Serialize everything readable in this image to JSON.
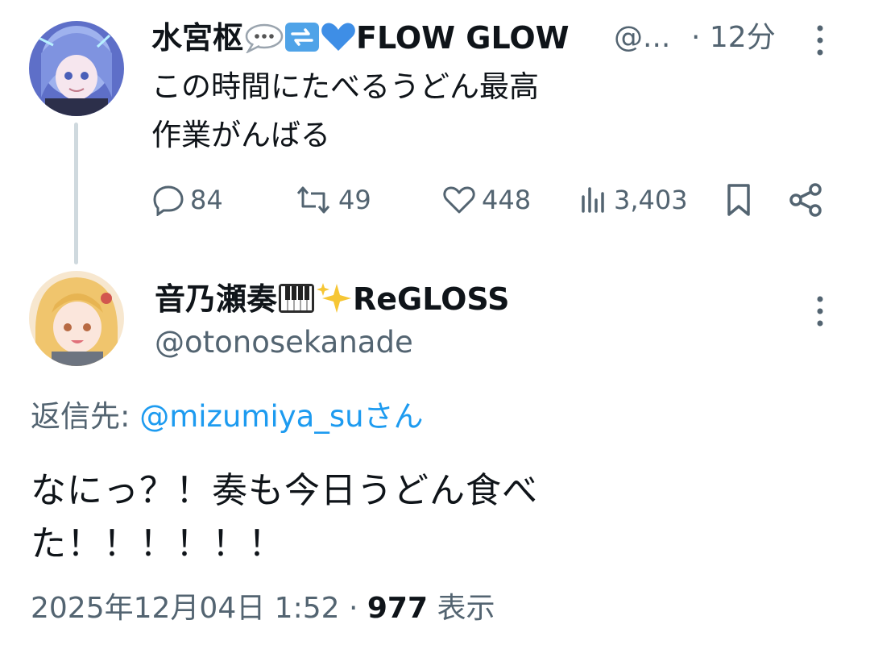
{
  "tweet1": {
    "display_name": "水宮枢",
    "name_suffix": "FLOW GLOW",
    "handle": "@...",
    "time": "· 12分",
    "text_line1": "この時間にたべるうどん最高",
    "text_line2": "作業がんばる",
    "stats": {
      "replies": "84",
      "reposts": "49",
      "likes": "448",
      "views": "3,403"
    },
    "avatar_color": "#7c8fd0"
  },
  "tweet2": {
    "display_name": "音乃瀬奏",
    "name_suffix": "ReGLOSS",
    "handle": "@otonosekanade",
    "reply_prefix": "返信先: ",
    "reply_target": "@mizumiya_suさん",
    "text_line1": "なにっ？！奏も今日うどん食べ",
    "text_line2": "た！！！！！！",
    "date": "2025年12月04日 1:52 · ",
    "view_count": "977",
    "view_label": " 表示",
    "avatar_color": "#f1c98a"
  },
  "colors": {
    "accent": "#1d9bf0",
    "muted": "#536471"
  }
}
